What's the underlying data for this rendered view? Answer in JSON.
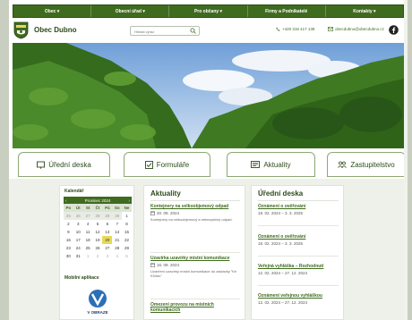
{
  "nav": {
    "items": [
      "Obec ▾",
      "Obecní úřad ▾",
      "Pro občany ▾",
      "Firmy a Podnikatelé",
      "Kontakty ▾"
    ]
  },
  "header": {
    "title": "Obec Dubno",
    "search_placeholder": "Hledat výraz",
    "phone": "+420 318 417 138",
    "email": "obecdubno@obecdubno.cz"
  },
  "tabs": [
    "Úřední deska",
    "Formuláře",
    "Aktuality",
    "Zastupitelstvo"
  ],
  "sidebar": {
    "calendar_title": "Kalendář",
    "month_label": "Prosinec 2024",
    "weekdays": [
      "Po",
      "Út",
      "St",
      "Čt",
      "Pá",
      "So",
      "Ne"
    ],
    "days": [
      [
        "25",
        "26",
        "27",
        "28",
        "29",
        "30",
        "1"
      ],
      [
        "2",
        "3",
        "4",
        "5",
        "6",
        "7",
        "8"
      ],
      [
        "9",
        "10",
        "11",
        "12",
        "13",
        "14",
        "15"
      ],
      [
        "16",
        "17",
        "18",
        "19",
        "20",
        "21",
        "22"
      ],
      [
        "23",
        "24",
        "25",
        "26",
        "27",
        "28",
        "29"
      ],
      [
        "30",
        "31",
        "1",
        "2",
        "3",
        "4",
        "5"
      ]
    ],
    "today": "20",
    "app_title": "Mobilní aplikace",
    "app_logo_text": "V OBRAZE"
  },
  "aktuality": {
    "title": "Aktuality",
    "items": [
      {
        "title": "Kontejnery na velkoobjemový odpad",
        "date": "20. 09. 2024",
        "desc": "Kontejnery na velkoobjemový a nebezpečný odpad."
      },
      {
        "title": "Uzavírka uzavírky místní komunikace",
        "date": "16. 09. 2024",
        "desc": "Uzavření uzavírky místní komunikace do zastávky \"Ke Křížku\""
      },
      {
        "title": "Omezení provozu na místních komunikacích",
        "date": "",
        "desc": ""
      }
    ]
  },
  "deska": {
    "title": "Úřední deska",
    "items": [
      {
        "title": "Oznámení o ověřování",
        "date": "18. 02. 2024 – 3. 3. 2025"
      },
      {
        "title": "Oznámení o ověřování",
        "date": "18. 02. 2024 – 3. 3. 2025"
      },
      {
        "title": "Veřejná vyhláška – Rozhodnutí",
        "date": "12. 02. 2024 – 27. 12. 2024"
      },
      {
        "title": "Oznámení veřejnou vyhláškou",
        "date": "12. 02. 2024 – 27. 12. 2024"
      }
    ]
  },
  "colors": {
    "nav_green": "#3f6b1f",
    "link_green": "#3f6b1f",
    "today_yellow": "#e7d85a"
  }
}
